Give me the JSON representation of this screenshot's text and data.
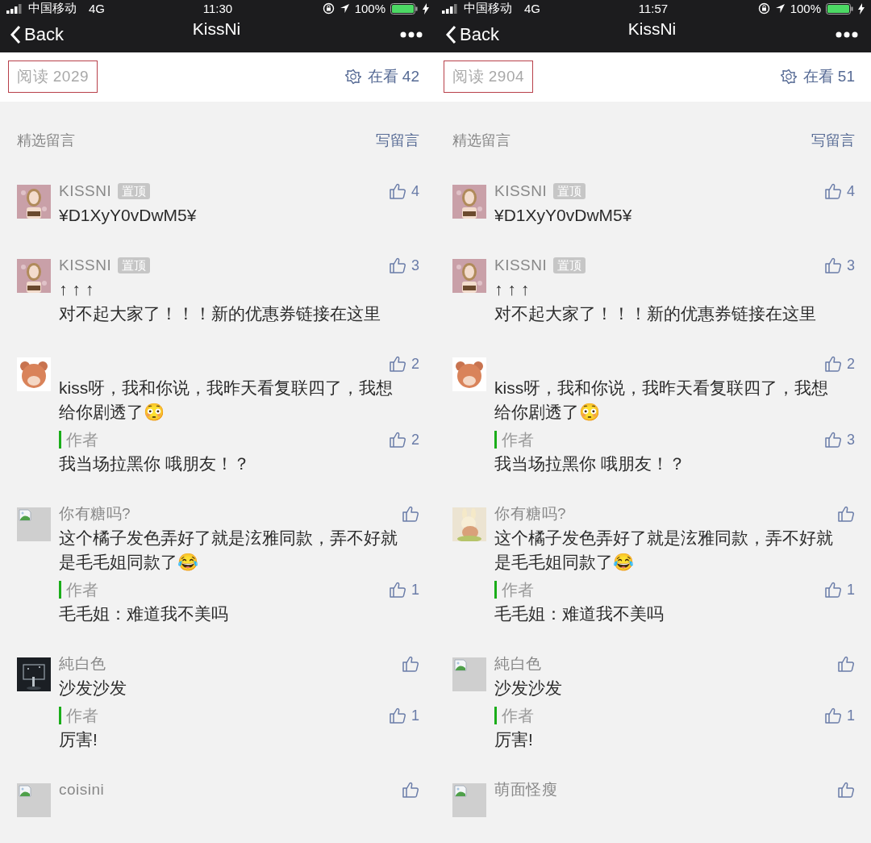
{
  "phones": [
    {
      "status_bar": {
        "carrier": "中国移动",
        "network": "4G",
        "time": "11:30",
        "battery": "100%"
      },
      "nav": {
        "back": "Back",
        "title": "KissNi"
      },
      "stats": {
        "read": {
          "text": "阅读 2029",
          "highlighted": true
        },
        "watching": "在看 42"
      },
      "comments_header": {
        "title": "精选留言",
        "write": "写留言"
      },
      "comments": [
        {
          "avatar": {
            "kind": "portrait"
          },
          "name": "KISSNI",
          "tag": "置顶",
          "likes": "4",
          "text": "¥D1XyY0vDwM5¥"
        },
        {
          "avatar": {
            "kind": "portrait"
          },
          "name": "KISSNI",
          "tag": "置顶",
          "likes": "3",
          "text": "↑ ↑ ↑\n对不起大家了！！！新的优惠券链接在这里"
        },
        {
          "avatar": {
            "kind": "bear"
          },
          "likes": "2",
          "text": "kiss呀，我和你说，我昨天看复联四了，我想给你剧透了😳",
          "reply": {
            "label": "作者",
            "likes": "2",
            "text": "我当场拉黑你 哦朋友！？"
          }
        },
        {
          "avatar": {
            "kind": "broken"
          },
          "name": "你有糖吗?",
          "text": "这个橘子发色弄好了就是泫雅同款，弄不好就是毛毛姐同款了😂",
          "reply": {
            "label": "作者",
            "likes": "1",
            "text": "毛毛姐：难道我不美吗"
          }
        },
        {
          "name": "純白色",
          "text": "沙发沙发",
          "reply": {
            "label": "作者",
            "likes": "1",
            "text": "厉害!"
          }
        },
        {
          "avatar": {
            "kind": "broken"
          },
          "name": "coisini"
        }
      ]
    },
    {
      "status_bar": {
        "carrier": "中国移动",
        "network": "4G",
        "time": "11:57",
        "battery": "100%"
      },
      "nav": {
        "back": "Back",
        "title": "KissNi"
      },
      "stats": {
        "read": {
          "text": "阅读 2904",
          "highlighted": true
        },
        "watching": "在看 51"
      },
      "comments_header": {
        "title": "精选留言",
        "write": "写留言"
      },
      "comments": [
        {
          "avatar": {
            "kind": "portrait"
          },
          "name": "KISSNI",
          "tag": "置顶",
          "likes": "4",
          "text": "¥D1XyY0vDwM5¥"
        },
        {
          "avatar": {
            "kind": "portrait"
          },
          "name": "KISSNI",
          "tag": "置顶",
          "likes": "3",
          "text": "↑ ↑ ↑\n对不起大家了！！！新的优惠券链接在这里"
        },
        {
          "avatar": {
            "kind": "bear"
          },
          "likes": "2",
          "text": "kiss呀，我和你说，我昨天看复联四了，我想给你剧透了😳",
          "reply": {
            "label": "作者",
            "likes": "3",
            "text": "我当场拉黑你 哦朋友！？"
          }
        },
        {
          "avatar": {
            "kind": "toy"
          },
          "name": "你有糖吗?",
          "text": "这个橘子发色弄好了就是泫雅同款，弄不好就是毛毛姐同款了😂",
          "reply": {
            "label": "作者",
            "likes": "1",
            "text": "毛毛姐：难道我不美吗"
          }
        },
        {
          "avatar": {
            "kind": "broken"
          },
          "name": "純白色",
          "text": "沙发沙发",
          "reply": {
            "label": "作者",
            "likes": "1",
            "text": "厉害!"
          }
        },
        {
          "avatar": {
            "kind": "broken"
          },
          "name": "萌面怪瘦"
        }
      ]
    }
  ]
}
